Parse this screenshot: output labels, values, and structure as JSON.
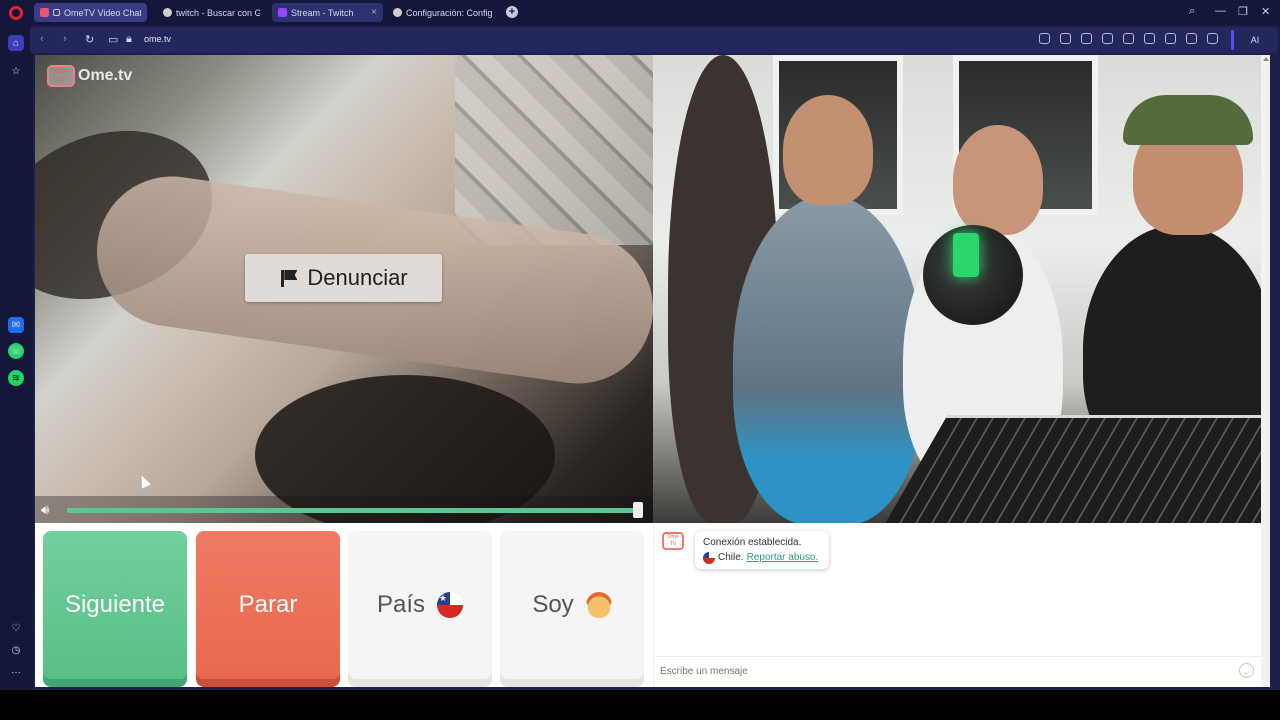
{
  "tabs": [
    {
      "label": "OmeTV Video Chat -",
      "favicon_color": "#e8567c"
    },
    {
      "label": "twitch - Buscar con Googl",
      "favicon_color": "#cfcfcf"
    },
    {
      "label": "Stream - Twitch",
      "favicon_color": "#9146ff"
    },
    {
      "label": "Configuración: Configurac",
      "favicon_color": "#cfcfcf"
    }
  ],
  "address": {
    "url": "ome.tv",
    "ai_label": "AI"
  },
  "video": {
    "logo_text": "Ome.tv",
    "report_label": "Denunciar",
    "volume_level": 1.0
  },
  "controls": {
    "next_label": "Siguiente",
    "stop_label": "Parar",
    "country_label": "País",
    "gender_label": "Soy"
  },
  "chat": {
    "status": "Conexión establecida.",
    "country": "Chile.",
    "report_abuse": "Reportar abuso.",
    "input_placeholder": "Escribe un mensaje"
  },
  "colors": {
    "next": "#62c58f",
    "stop": "#ec7258",
    "accent": "#3d3fb8"
  }
}
